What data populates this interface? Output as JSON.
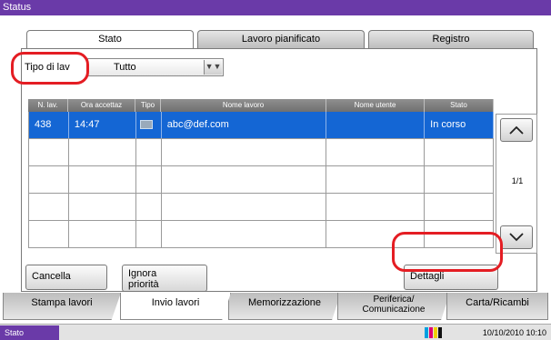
{
  "window": {
    "title": "Status"
  },
  "top_tabs": [
    {
      "label": "Stato",
      "active": true
    },
    {
      "label": "Lavoro pianificato",
      "active": false
    },
    {
      "label": "Registro",
      "active": false
    }
  ],
  "filter": {
    "label": "Tipo di lav",
    "value": "Tutto"
  },
  "table": {
    "headers": [
      "N. lav.",
      "Ora accettaz",
      "Tipo",
      "Nome lavoro",
      "Nome utente",
      "Stato"
    ],
    "rows": [
      {
        "job_no": "438",
        "time": "14:47",
        "type_icon": "send-job-icon",
        "job_name": "abc@def.com",
        "user": "",
        "status": "In corso",
        "selected": true
      },
      {
        "job_no": "",
        "time": "",
        "type_icon": "",
        "job_name": "",
        "user": "",
        "status": "",
        "selected": false
      },
      {
        "job_no": "",
        "time": "",
        "type_icon": "",
        "job_name": "",
        "user": "",
        "status": "",
        "selected": false
      },
      {
        "job_no": "",
        "time": "",
        "type_icon": "",
        "job_name": "",
        "user": "",
        "status": "",
        "selected": false
      },
      {
        "job_no": "",
        "time": "",
        "type_icon": "",
        "job_name": "",
        "user": "",
        "status": "",
        "selected": false
      }
    ]
  },
  "pager": {
    "indicator": "1/1",
    "up_icon": "chevron-up-icon",
    "down_icon": "chevron-down-icon"
  },
  "buttons": {
    "cancel": "Cancella",
    "ignore_line1": "Ignora",
    "ignore_line2": "priorità",
    "details": "Dettagli"
  },
  "bottom_tabs": [
    {
      "label": "Stampa lavori",
      "active": false
    },
    {
      "label": "Invio lavori",
      "active": true
    },
    {
      "label": "Memorizzazione",
      "active": false
    },
    {
      "label_line1": "Periferica/",
      "label_line2": "Comunicazione",
      "active": false
    },
    {
      "label": "Carta/Ricambi",
      "active": false
    }
  ],
  "statusbar": {
    "status": "Stato",
    "datetime": "10/10/2010  10:10",
    "toner_colors": [
      "#00a0e0",
      "#e0006f",
      "#f0d000",
      "#111111"
    ]
  },
  "colors": {
    "accent": "#6a3aa8",
    "selection": "#1466d4",
    "highlight_ring": "#e41d23"
  }
}
